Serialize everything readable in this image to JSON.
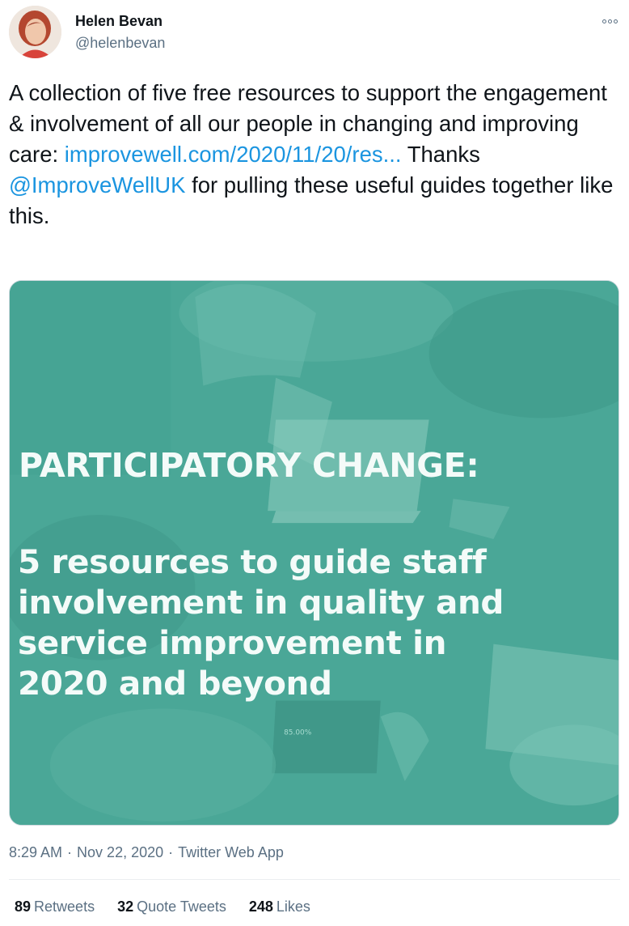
{
  "author": {
    "name": "Helen Bevan",
    "handle": "@helenbevan"
  },
  "tweet": {
    "text_part1": "A collection of five free resources to support the engagement & involvement of all our people in changing and improving care: ",
    "link": "improvewell.com/2020/11/20/res...",
    "text_part2": " Thanks ",
    "mention": "@ImproveWellUK",
    "text_part3": " for pulling these useful guides together like this."
  },
  "media": {
    "headline": "PARTICIPATORY CHANGE:",
    "subtitle_lines": [
      "5 resources to guide staff",
      "involvement in quality and",
      "service improvement in",
      "2020 and beyond"
    ],
    "screen_text": "85.00%"
  },
  "meta": {
    "time": "8:29 AM",
    "date": "Nov 22, 2020",
    "separator": "·",
    "source": "Twitter Web App"
  },
  "stats": {
    "retweets_count": "89",
    "retweets_label": "Retweets",
    "quotes_count": "32",
    "quotes_label": "Quote Tweets",
    "likes_count": "248",
    "likes_label": "Likes"
  },
  "colors": {
    "link": "#1b95e0",
    "muted": "#5b7083",
    "media_tint": "#4aa797"
  }
}
